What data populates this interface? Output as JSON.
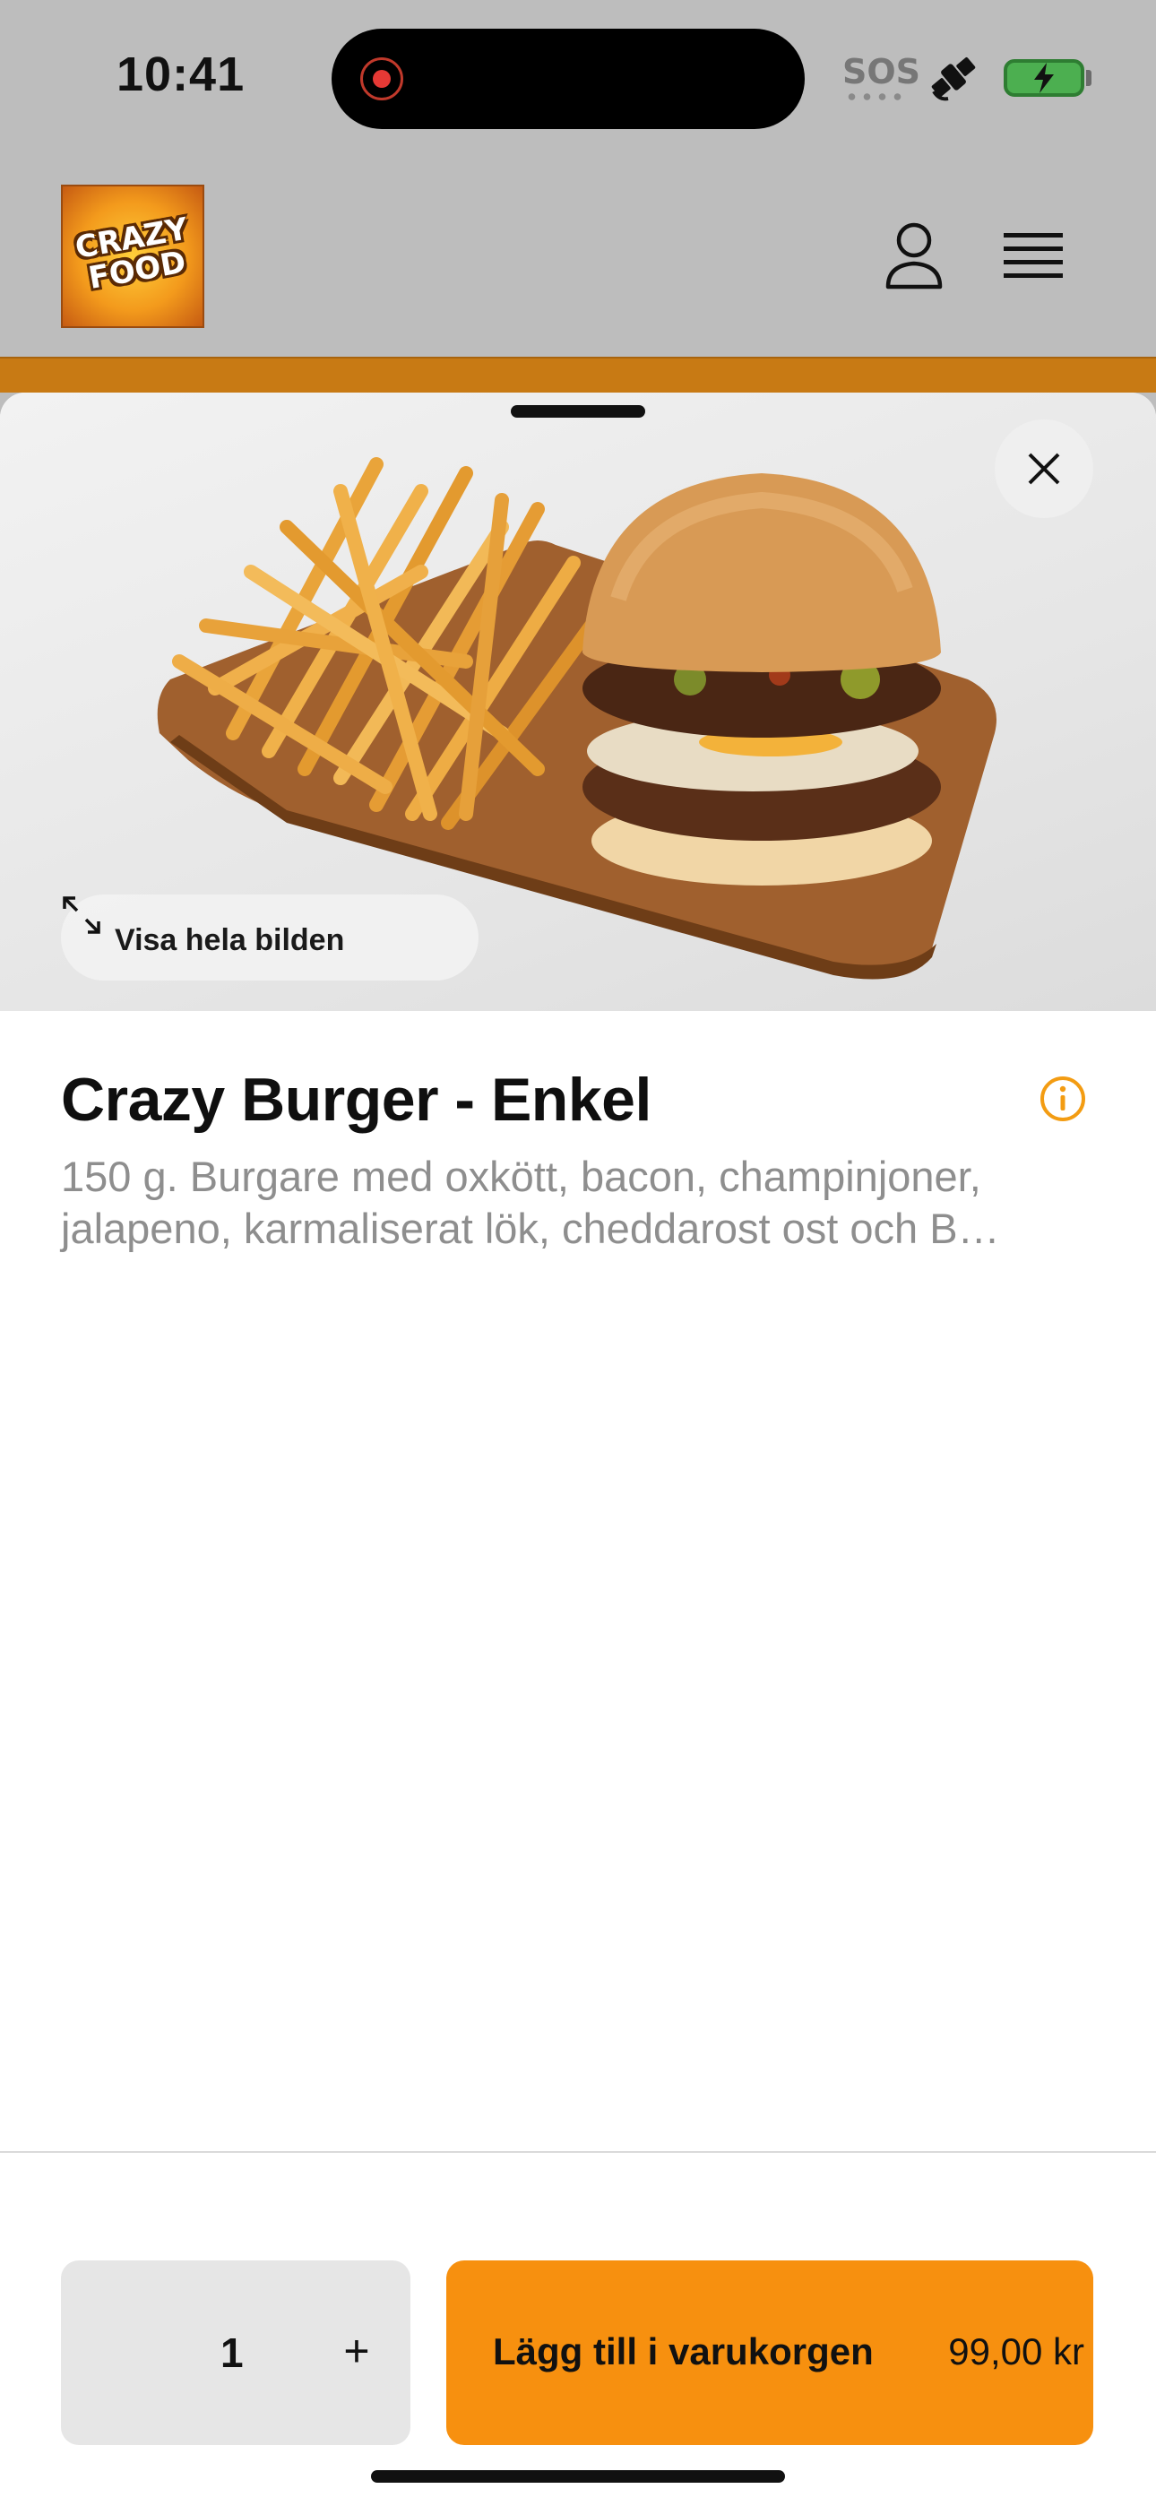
{
  "status_bar": {
    "time": "10:41",
    "sos": "SOS",
    "icons": [
      "screen-record-icon",
      "satellite-icon",
      "battery-charging-icon"
    ],
    "battery_color": "#4caf50"
  },
  "header": {
    "logo_text": "CRAZY FOOD",
    "icons": [
      "user-icon",
      "menu-icon"
    ]
  },
  "product": {
    "view_full_image_label": "Visa hela bilden",
    "title": "Crazy Burger - Enkel",
    "description": "150 g. Burgare med oxkött, bacon, champinjoner, jalapeno, karmaliserat lök, cheddarost ost och B…"
  },
  "cart": {
    "quantity": "1",
    "plus_label": "+",
    "add_label": "Lägg till i varukorgen",
    "price": "99,00 kr"
  },
  "colors": {
    "accent": "#f7900f",
    "info_icon": "#f39c12"
  }
}
